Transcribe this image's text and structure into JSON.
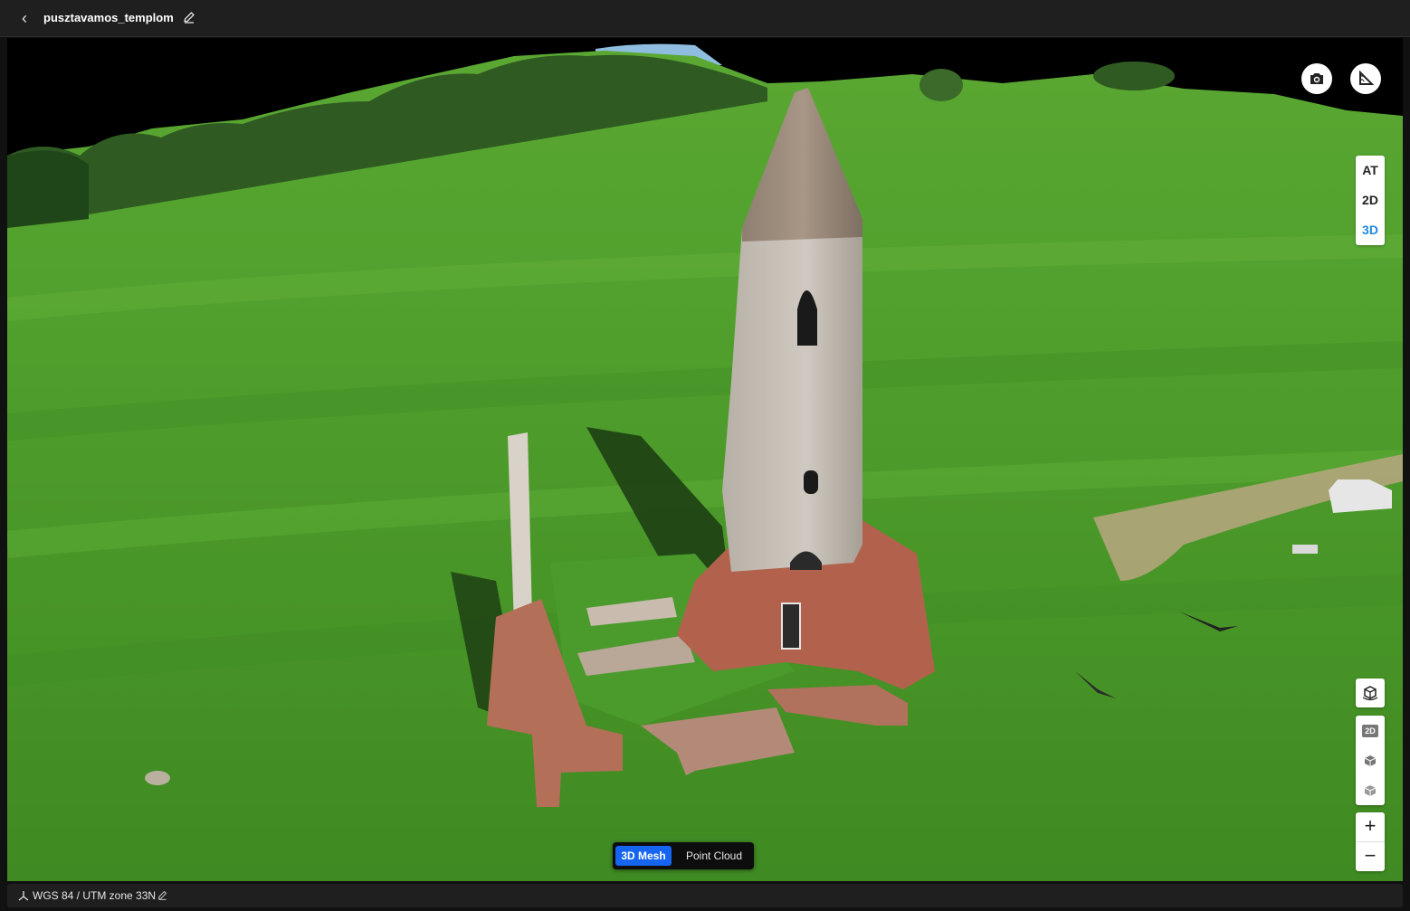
{
  "header": {
    "back_label": "‹",
    "project_title": "pusztavamos_templom"
  },
  "view_modes": {
    "items": [
      "AT",
      "2D",
      "3D"
    ],
    "active": "3D"
  },
  "tools": {
    "map_2d_label": "2D",
    "zoom_in": "+",
    "zoom_out": "−"
  },
  "data_mode": {
    "mesh_label": "3D Mesh",
    "pointcloud_label": "Point Cloud",
    "active": "3D Mesh"
  },
  "footer": {
    "crs_label": "WGS 84 / UTM zone 33N"
  },
  "icons": {
    "back": "chevron-left-icon",
    "edit": "pencil-icon",
    "screenshot": "camera-icon",
    "measure": "ruler-triangle-icon",
    "cube_rotate": "rotate-3d-icon",
    "cube": "cube-icon",
    "crs": "axes-icon"
  },
  "colors": {
    "accent": "#1e88e5",
    "toggle_active": "#1565f0",
    "bar": "#1f1f1f"
  }
}
